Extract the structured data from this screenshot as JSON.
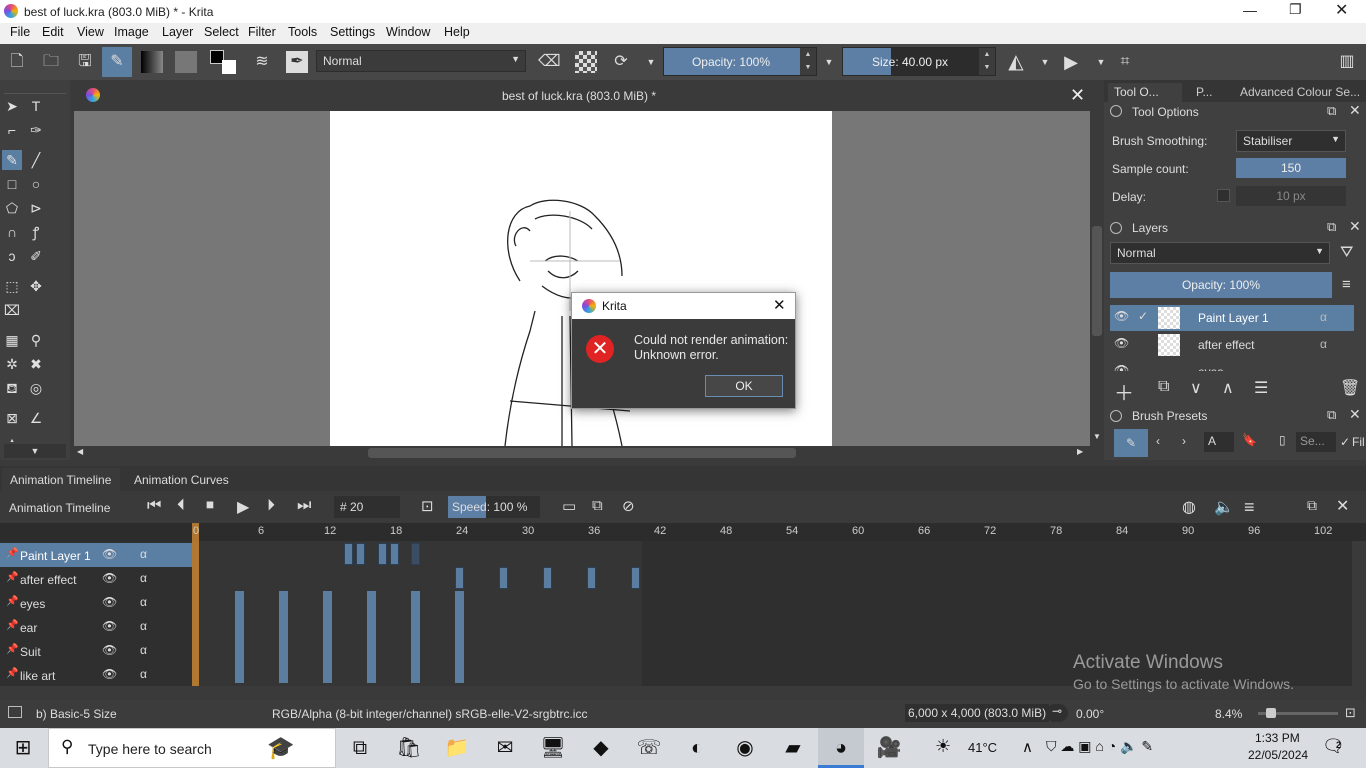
{
  "window": {
    "title": "best of luck.kra (803.0 MiB) * - Krita"
  },
  "menu": [
    "File",
    "Edit",
    "View",
    "Image",
    "Layer",
    "Select",
    "Filter",
    "Tools",
    "Settings",
    "Window",
    "Help"
  ],
  "toolbar": {
    "blend_mode": "Normal",
    "opacity_label": "Opacity: 100%",
    "opacity_value": 1.0,
    "size_label": "Size: 40.00 px"
  },
  "document": {
    "tab_title": "best of luck.kra (803.0 MiB) *"
  },
  "dialog": {
    "title": "Krita",
    "message_line1": "Could not render animation:",
    "message_line2": "Unknown error.",
    "ok_label": "OK"
  },
  "right_panel": {
    "tabs": [
      "Tool O...",
      "P...",
      "Advanced Colour Se..."
    ],
    "tool_options_title": "Tool Options",
    "brush_smoothing_label": "Brush Smoothing:",
    "brush_smoothing_value": "Stabiliser",
    "sample_count_label": "Sample count:",
    "sample_count_value": "150",
    "delay_label": "Delay:",
    "delay_value": "10 px",
    "layers_title": "Layers",
    "layers_blend": "Normal",
    "layers_opacity": "Opacity:  100%",
    "layers": [
      "Paint Layer 1",
      "after effect",
      "eyes"
    ],
    "brush_presets_title": "Brush Presets",
    "preset_filter": "A",
    "preset_search": "Se...",
    "preset_fil": "Fil"
  },
  "animation": {
    "tabs": [
      "Animation Timeline",
      "Animation Curves"
    ],
    "title": "Animation Timeline",
    "frame_label": "# 20",
    "speed_label": "Speed: 100 %",
    "ticks": [
      "0",
      "6",
      "12",
      "18",
      "24",
      "30",
      "36",
      "42",
      "48",
      "54",
      "60",
      "66",
      "72",
      "78",
      "84",
      "90",
      "96",
      "102"
    ],
    "layers": [
      "Paint Layer 1",
      "after effect",
      "eyes",
      "ear",
      "Suit",
      "like art"
    ],
    "watermark1": "Activate Windows",
    "watermark2": "Go to Settings to activate Windows."
  },
  "status": {
    "brush": "b) Basic-5 Size",
    "color": "RGB/Alpha (8-bit integer/channel)  sRGB-elle-V2-srgbtrc.icc",
    "dims": "6,000 x 4,000 (803.0 MiB)",
    "rotation": "0.00°",
    "zoom": "8.4%"
  },
  "taskbar": {
    "search_placeholder": "Type here to search",
    "temperature": "41°C",
    "time": "1:33 PM",
    "date": "22/05/2024",
    "notifications": "2"
  }
}
